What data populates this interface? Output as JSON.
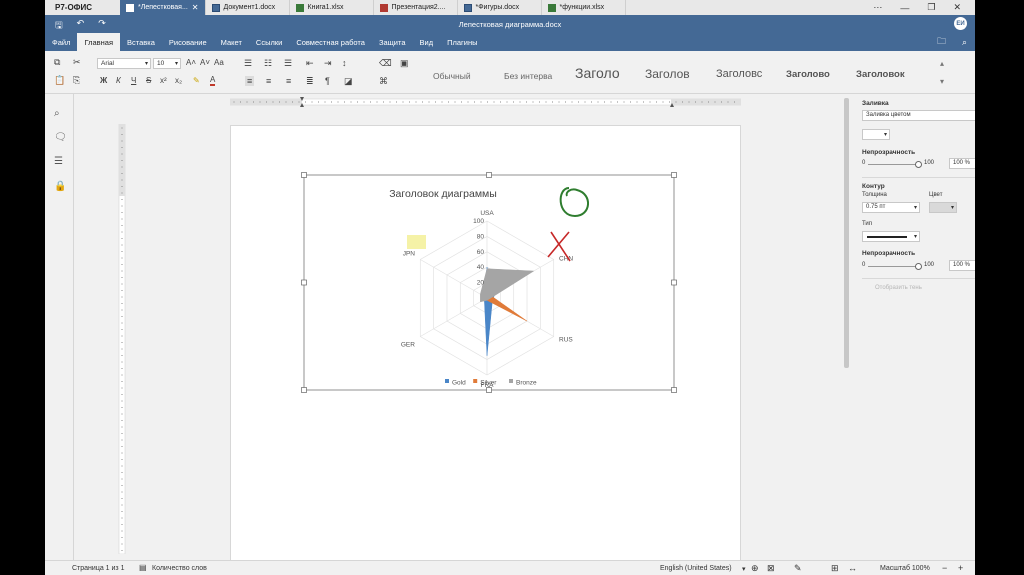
{
  "app": {
    "logo": "Р7-ОФИС"
  },
  "tabs": [
    {
      "label": "*Лепестковая...",
      "kind": "word",
      "active": true
    },
    {
      "label": "Документ1.docx",
      "kind": "word",
      "active": false
    },
    {
      "label": "Книга1.xlsx",
      "kind": "excel",
      "active": false
    },
    {
      "label": "Презентация2....",
      "kind": "pres",
      "active": false
    },
    {
      "label": "*Фигуры.docx",
      "kind": "word",
      "active": false
    },
    {
      "label": "*функции.xlsx",
      "kind": "excel",
      "active": false
    }
  ],
  "window": {
    "title": "Лепестковая диаграмма.docx",
    "avatar": "ЕИ"
  },
  "menu": [
    "Файл",
    "Главная",
    "Вставка",
    "Рисование",
    "Макет",
    "Ссылки",
    "Совместная работа",
    "Защита",
    "Вид",
    "Плагины"
  ],
  "menu_active": 1,
  "toolbar": {
    "font_name": "Arial",
    "font_size": "10",
    "bold": "Ж",
    "italic": "К",
    "underline": "Ч",
    "strike": "S",
    "styles": [
      "Обычный",
      "Без интерва",
      "Заголо",
      "Заголов",
      "Заголовс",
      "Заголово",
      "Заголовок"
    ]
  },
  "panel": {
    "fill_title": "Заливка",
    "fill_type": "Заливка цветом",
    "opacity_label": "Непрозрачность",
    "opacity_min": "0",
    "opacity_max": "100",
    "opacity_value": "100 %",
    "stroke_title": "Контур",
    "thickness_label": "Толщина",
    "color_label": "Цвет",
    "thickness_value": "0.75 пт",
    "type_label": "Тип",
    "opacity2_label": "Непрозрачность",
    "opacity2_min": "0",
    "opacity2_max": "100",
    "opacity2_value": "100 %",
    "show_shadow": "Отобразить тень"
  },
  "status": {
    "page": "Страница 1 из 1",
    "word_count": "Количество слов",
    "language": "English (United States)",
    "zoom": "Масштаб 100%"
  },
  "chart_data": {
    "type": "radar",
    "title": "Заголовок диаграммы",
    "categories": [
      "USA",
      "CHN",
      "RUS",
      "FRA",
      "GER",
      "JPN"
    ],
    "rlim": [
      0,
      100
    ],
    "ticks": [
      "20",
      "40",
      "60",
      "80",
      "100"
    ],
    "series": [
      {
        "name": "Gold",
        "color": "#4a86c8",
        "values": [
          40,
          12,
          8,
          75,
          4,
          6
        ]
      },
      {
        "name": "Silver",
        "color": "#e07b39",
        "values": [
          3,
          6,
          60,
          3,
          3,
          3
        ]
      },
      {
        "name": "Bronze",
        "color": "#a5a5a5",
        "values": [
          38,
          70,
          3,
          3,
          10,
          10
        ]
      }
    ],
    "legend": "bottom"
  }
}
